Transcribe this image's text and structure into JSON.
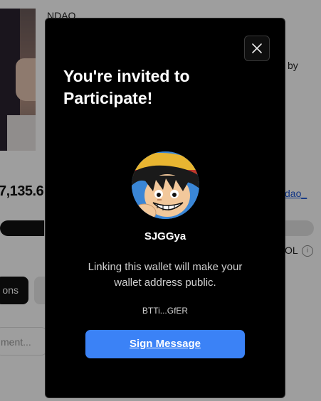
{
  "background": {
    "title": "NDAO",
    "by_text": "by",
    "amount": "7,135.6",
    "link_text": "dao_",
    "progress_fraction": 0.14,
    "ol_text": "OL",
    "info_icon": "info-icon",
    "dark_button_label": "ons",
    "input_placeholder": "ment..."
  },
  "modal": {
    "title": "You're invited to Participate!",
    "close_icon": "close-icon",
    "username": "SJGGya",
    "description": "Linking this wallet will make your wallet address public.",
    "wallet_address": "BTTi...GfER",
    "sign_button_label": "Sign Message",
    "colors": {
      "background": "#000000",
      "button": "#3b82f6"
    }
  }
}
